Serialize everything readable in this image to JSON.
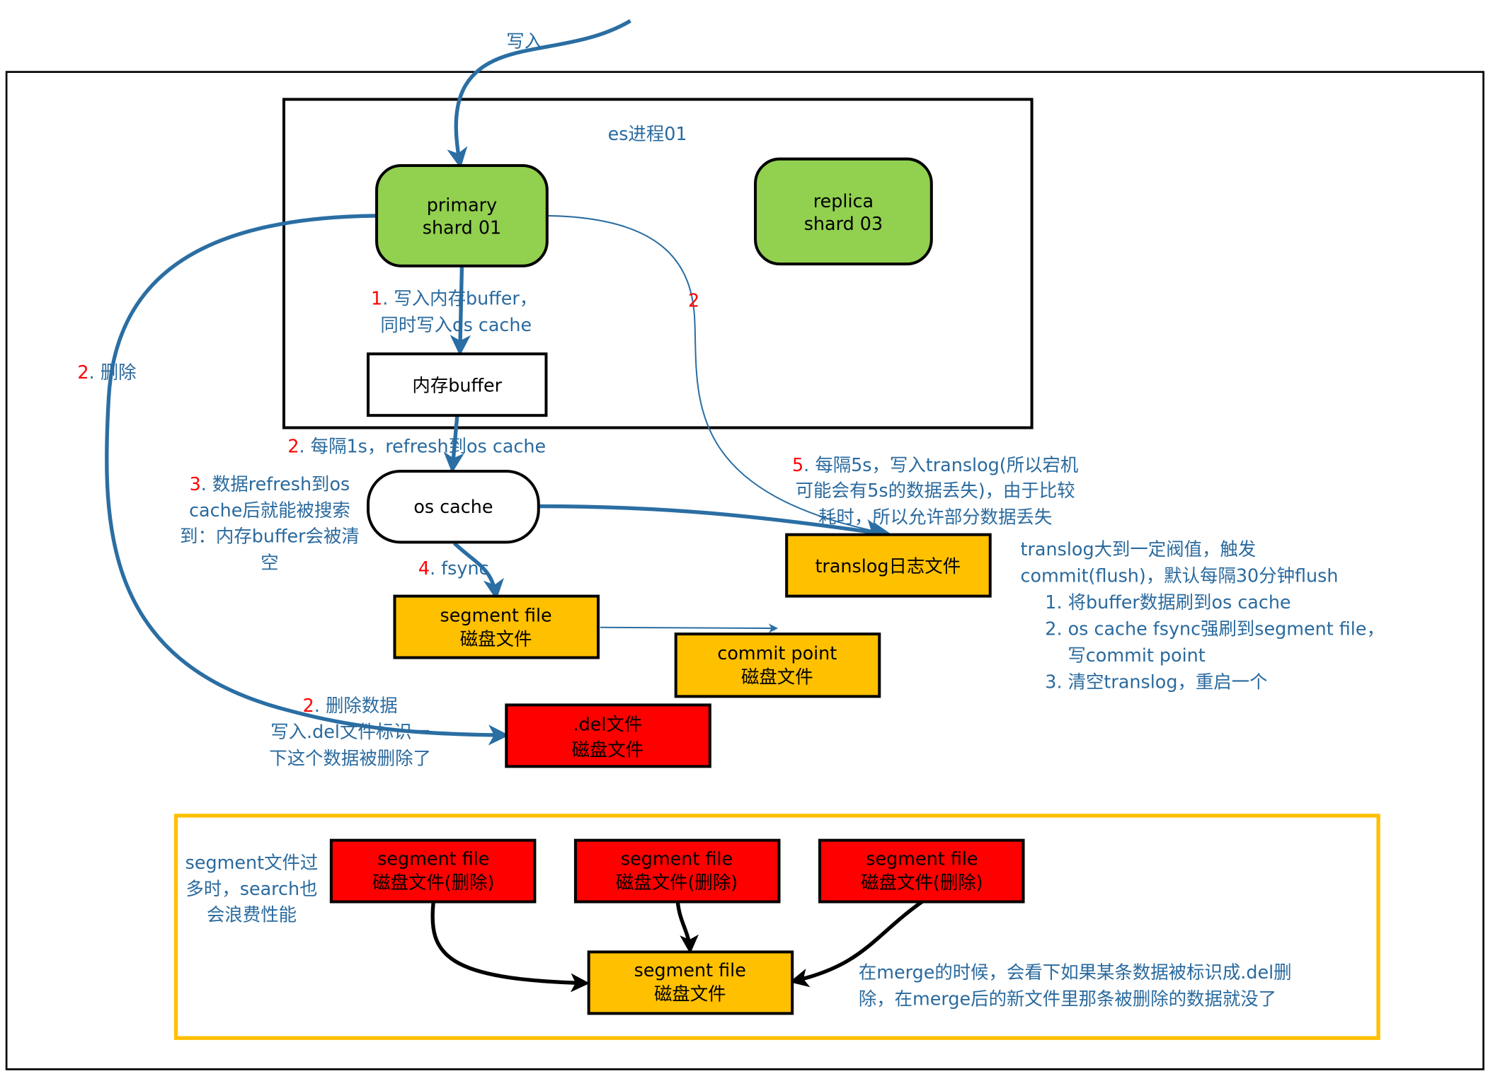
{
  "colors": {
    "edge_blue": "#2a6ea3",
    "label_blue": "#2a6a9e",
    "number_red": "#ff0000",
    "shard_green": "#92d050",
    "file_orange": "#ffc000",
    "deleted_red": "#ff0000",
    "merge_frame": "#ffc000"
  },
  "top_label": "写入",
  "process_title": "es进程01",
  "nodes": {
    "primary": [
      "primary",
      "shard 01"
    ],
    "replica": [
      "replica",
      "shard 03"
    ],
    "buffer": "内存buffer",
    "oscache": "os cache",
    "translog": "translog日志文件",
    "segment": [
      "segment file",
      "磁盘文件"
    ],
    "commit": [
      "commit point",
      "磁盘文件"
    ],
    "del": [
      ".del文件",
      "磁盘文件"
    ]
  },
  "labels": {
    "step1": {
      "num": "1",
      "lines": [
        ". 写入内存buffer，",
        "同时写入os cache"
      ]
    },
    "step2_refresh": {
      "num": "2",
      "text": ". 每隔1s，refresh到os cache"
    },
    "step3": {
      "num": "3",
      "lines": [
        ". 数据refresh到os",
        "cache后就能被搜索",
        "到：内存buffer会被清",
        "空"
      ]
    },
    "step4": {
      "num": "4",
      "text": ". fsync"
    },
    "step5": {
      "num": "5",
      "lines": [
        ". 每隔5s，写入translog(所以宕机",
        "可能会有5s的数据丢失)，由于比较",
        "耗时，所以允许部分数据丢失"
      ]
    },
    "replica_edge": "2",
    "delete_left": {
      "num": "2",
      "text": ". 删除"
    },
    "delete_data": {
      "num": "2",
      "lines": [
        ". 删除数据",
        "写入.del文件标识一",
        "下这个数据被删除了"
      ]
    },
    "flush": [
      "translog大到一定阀值，触发",
      "commit(flush)，默认每隔30分钟flush",
      "1. 将buffer数据刷到os cache",
      "2. os cache fsync强刷到segment file，",
      "写commit point",
      "3. 清空translog，重启一个"
    ]
  },
  "merge": {
    "deleted_segments": [
      [
        "segment file",
        "磁盘文件(删除)"
      ],
      [
        "segment file",
        "磁盘文件(删除)"
      ],
      [
        "segment file",
        "磁盘文件(删除)"
      ]
    ],
    "merged_segment": [
      "segment file",
      "磁盘文件"
    ],
    "left_note": [
      "segment文件过",
      "多时，search也",
      "会浪费性能"
    ],
    "right_note": [
      "在merge的时候，会看下如果某条数据被标识成.del删",
      "除，在merge后的新文件里那条被删除的数据就没了"
    ]
  }
}
